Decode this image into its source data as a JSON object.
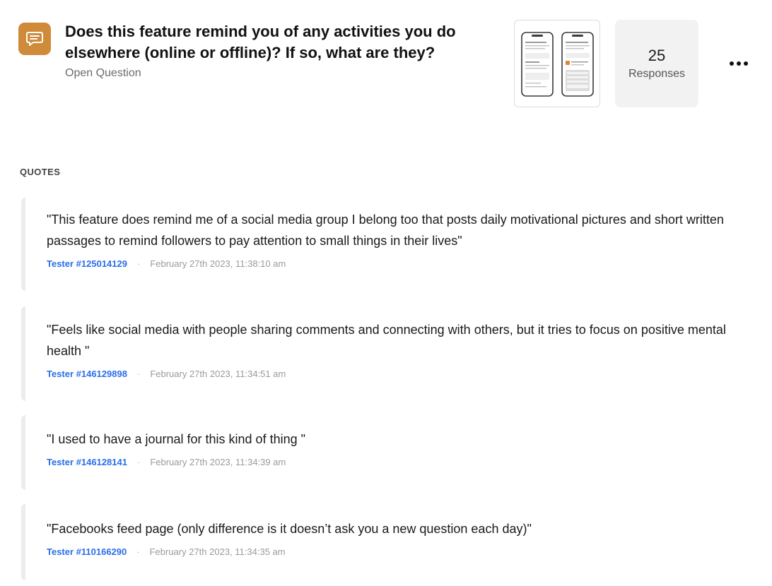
{
  "question": {
    "icon": "message-square-icon",
    "title": "Does this feature remind you of any activities you do elsewhere (online or offline)? If so, what are they?",
    "type": "Open Question",
    "accent_color": "#cf8a3a"
  },
  "responses": {
    "count": "25",
    "label": "Responses"
  },
  "more_icon": "more-horizontal-icon",
  "quotes_label": "QUOTES",
  "quotes": [
    {
      "text": "\"This feature does remind me of a social media group I belong too that posts daily motivational pictures and short written passages to remind followers to pay attention to small things in their lives\"",
      "tester": "Tester #125014129",
      "separator": "·",
      "date": "February 27th 2023, 11:38:10 am"
    },
    {
      "text": "\"Feels like social media with people sharing comments and connecting with others, but it tries to focus on positive mental health \"",
      "tester": "Tester #146129898",
      "separator": "·",
      "date": "February 27th 2023, 11:34:51 am"
    },
    {
      "text": "\"I used to have a journal for this kind of thing \"",
      "tester": "Tester #146128141",
      "separator": "·",
      "date": "February 27th 2023, 11:34:39 am"
    },
    {
      "text": "\"Facebooks feed page (only difference is it doesn’t ask you a new question each day)\"",
      "tester": "Tester #110166290",
      "separator": "·",
      "date": "February 27th 2023, 11:34:35 am"
    }
  ],
  "colors": {
    "tester_link": "#2a6ee8",
    "quote_border": "#ececee",
    "responses_bg": "#f2f2f3"
  }
}
